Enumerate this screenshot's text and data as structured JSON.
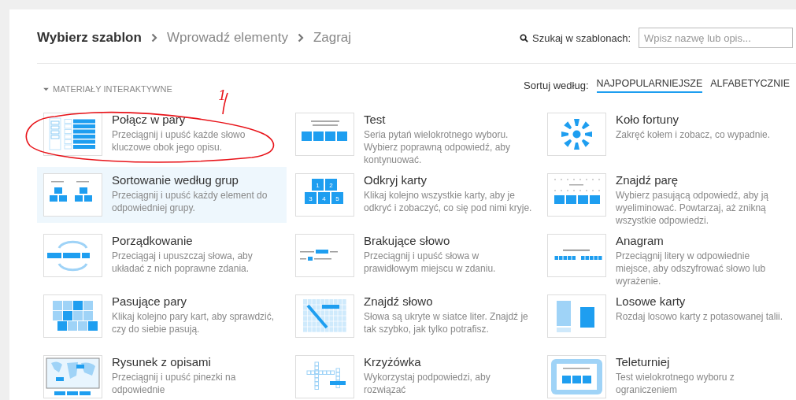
{
  "breadcrumb": [
    {
      "label": "Wybierz szablon",
      "selected": true
    },
    {
      "label": "Wprowadź elementy",
      "selected": false
    },
    {
      "label": "Zagraj",
      "selected": false
    }
  ],
  "search": {
    "label": "Szukaj w szablonach:",
    "placeholder": "Wpisz nazwę lub opis..."
  },
  "section": {
    "title": "MATERIAŁY INTERAKTYWNE",
    "expanded": true
  },
  "sort": {
    "label": "Sortuj według:",
    "options": [
      {
        "label": "NAJPOPULARNIEJSZE",
        "selected": true
      },
      {
        "label": "ALFABETYCZNIE",
        "selected": false
      }
    ]
  },
  "templates": [
    {
      "kind": "pairs",
      "title": "Połącz w pary",
      "description": "Przeciągnij i upuść każde słowo kluczowe obok jego opisu.",
      "selected": false
    },
    {
      "kind": "test",
      "title": "Test",
      "description": "Seria pytań wielokrotnego wyboru. Wybierz poprawną odpowiedź, aby kontynuować.",
      "selected": false
    },
    {
      "kind": "wheel",
      "title": "Koło fortuny",
      "description": "Zakręć kołem i zobacz, co wypadnie.",
      "selected": false
    },
    {
      "kind": "groups",
      "title": "Sortowanie według grup",
      "description": "Przeciągnij i upuść każdy element do odpowiedniej grupy.",
      "selected": true
    },
    {
      "kind": "cards",
      "title": "Odkryj karty",
      "description": "Klikaj kolejno wszystkie karty, aby je odkryć i zobaczyć, co się pod nimi kryje.",
      "selected": false,
      "thumb_labels": [
        "1",
        "2",
        "3",
        "4",
        "5"
      ]
    },
    {
      "kind": "findpair",
      "title": "Znajdź parę",
      "description": "Wybierz pasującą odpowiedź, aby ją wyeliminować. Powtarzaj, aż znikną wszystkie odpowiedzi.",
      "selected": false
    },
    {
      "kind": "order",
      "title": "Porządkowanie",
      "description": "Przeciągaj i upuszczaj słowa, aby układać z nich poprawne zdania.",
      "selected": false
    },
    {
      "kind": "missing",
      "title": "Brakujące słowo",
      "description": "Przeciągnij i upuść słowa w prawidłowym miejscu w zdaniu.",
      "selected": false
    },
    {
      "kind": "anagram",
      "title": "Anagram",
      "description": "Przeciągnij litery w odpowiednie miejsce, aby odszyfrować słowo lub wyrażenie.",
      "selected": false
    },
    {
      "kind": "matching",
      "title": "Pasujące pary",
      "description": "Klikaj kolejno pary kart, aby sprawdzić, czy do siebie pasują.",
      "selected": false
    },
    {
      "kind": "wordsearch",
      "title": "Znajdź słowo",
      "description": "Słowa są ukryte w siatce liter. Znajdź je tak szybko, jak tylko potrafisz.",
      "selected": false
    },
    {
      "kind": "random",
      "title": "Losowe karty",
      "description": "Rozdaj losowo karty z potasowanej talii.",
      "selected": false
    },
    {
      "kind": "diagram",
      "title": "Rysunek z opisami",
      "description": "Przeciągnij i upuść pinezki na odpowiednie",
      "selected": false
    },
    {
      "kind": "crossword",
      "title": "Krzyżówka",
      "description": "Wykorzystaj podpowiedzi, aby rozwiązać",
      "selected": false
    },
    {
      "kind": "quiz",
      "title": "Teleturniej",
      "description": "Test wielokrotnego wyboru z ograniczeniem",
      "selected": false
    }
  ],
  "annotation": {
    "label": "1"
  }
}
